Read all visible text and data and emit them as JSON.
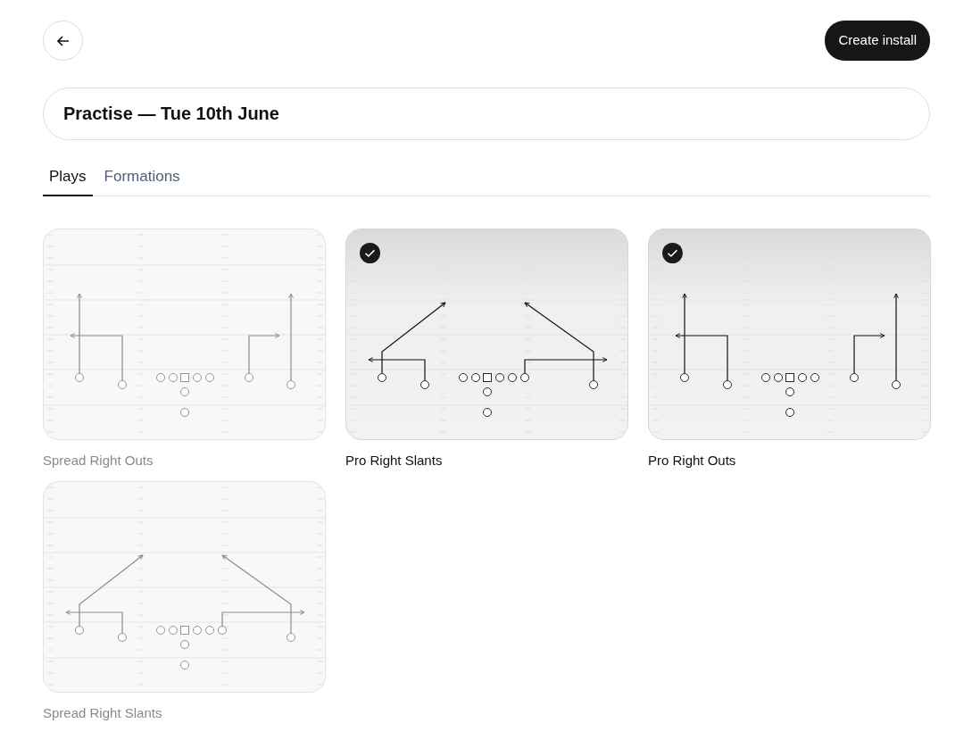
{
  "header": {
    "create_button": {
      "label": "Create install"
    }
  },
  "title_field": {
    "value": "Practise — Tue 10th June"
  },
  "tabs": [
    {
      "label": "Plays",
      "selected": true
    },
    {
      "label": "Formations",
      "selected": false
    }
  ],
  "plays": [
    {
      "name": "Spread Right Outs",
      "kind": "outs",
      "selected": false
    },
    {
      "name": "Pro Right Slants",
      "kind": "slants",
      "selected": true
    },
    {
      "name": "Pro Right Outs",
      "kind": "outs",
      "selected": true
    },
    {
      "name": "Spread Right Slants",
      "kind": "slants",
      "selected": false
    }
  ]
}
